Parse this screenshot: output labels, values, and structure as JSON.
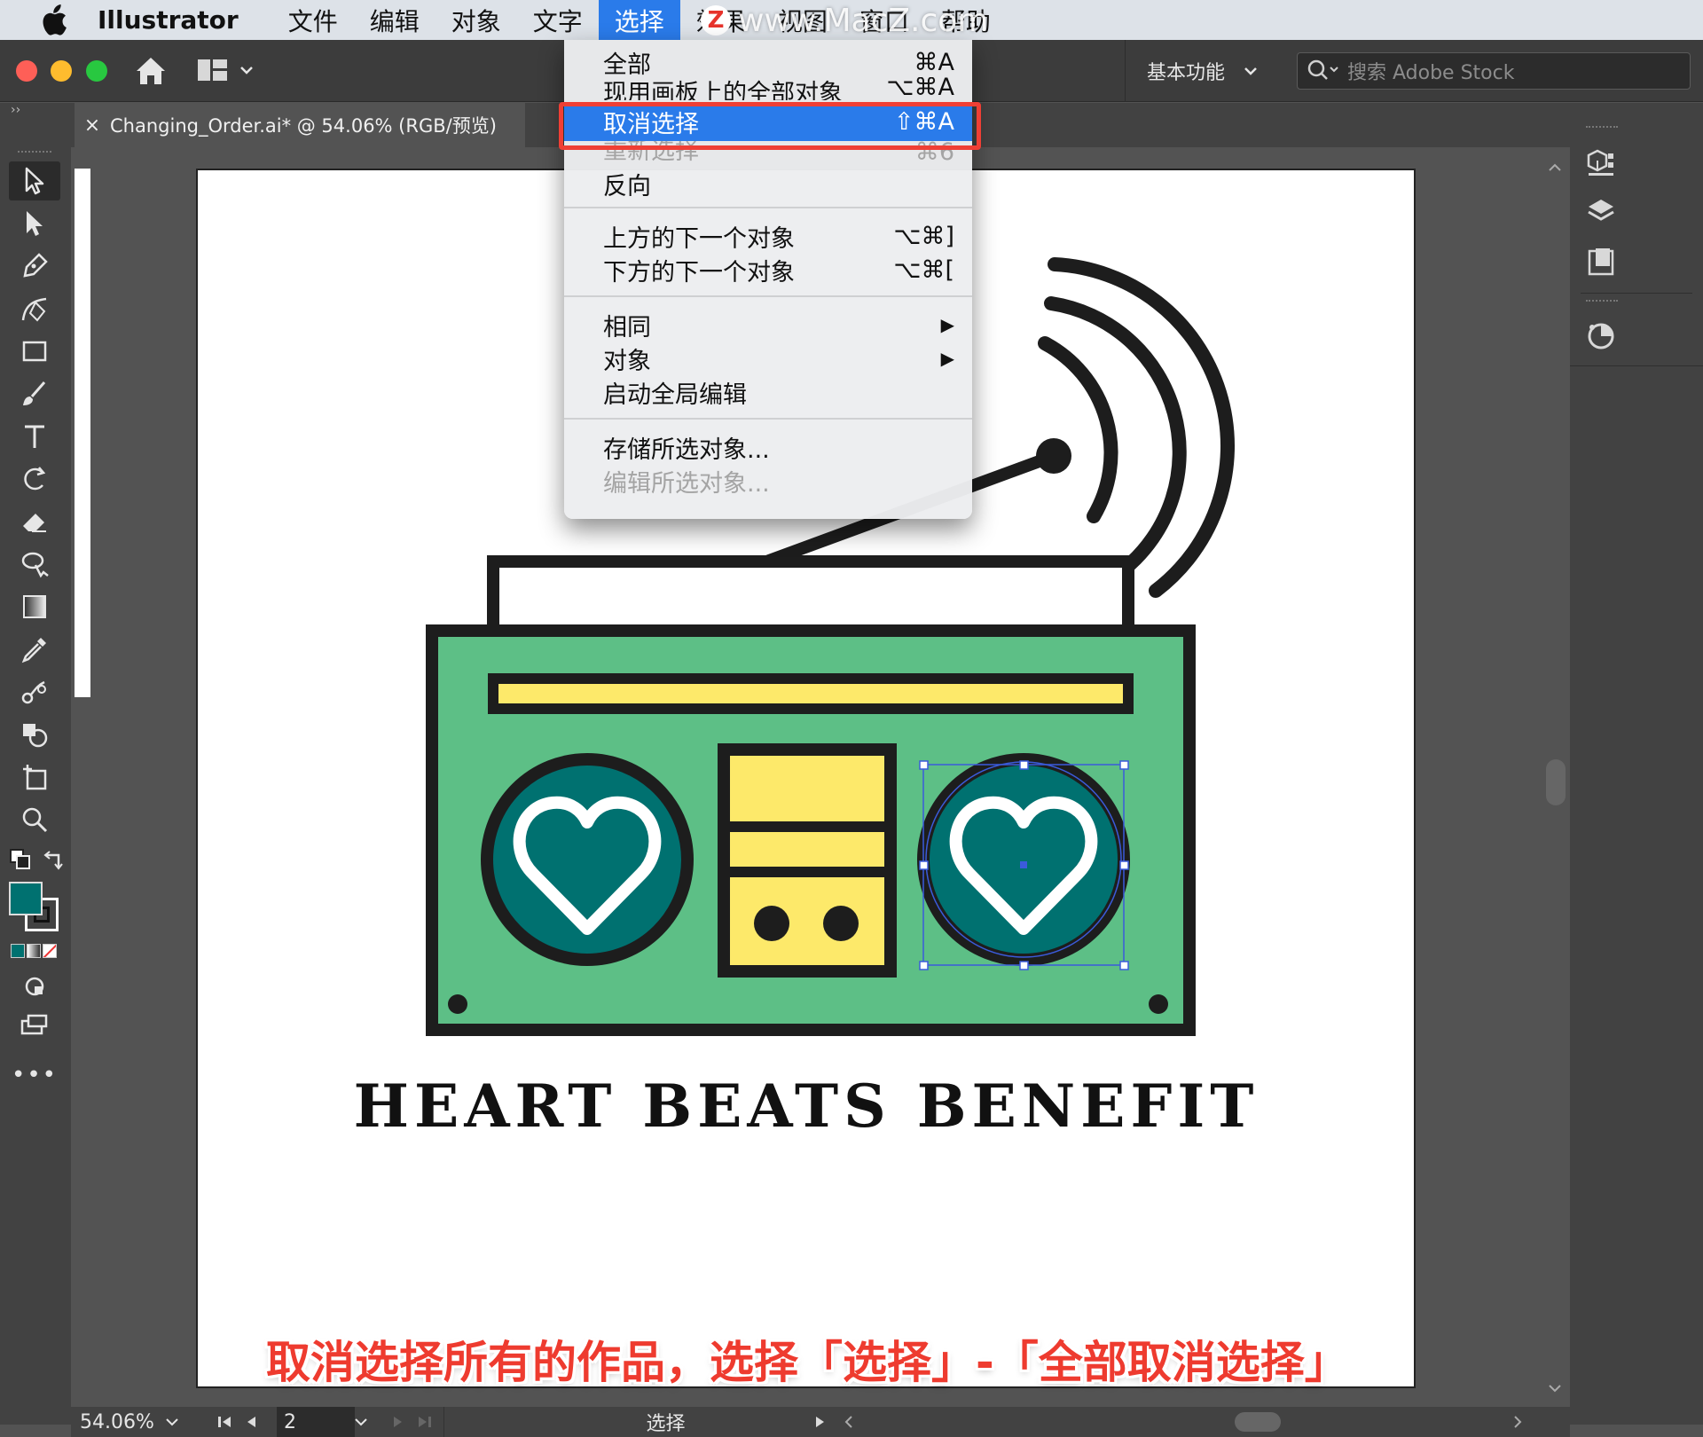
{
  "menubar": {
    "app_name": "Illustrator",
    "items": [
      "文件",
      "编辑",
      "对象",
      "文字",
      "选择",
      "效果",
      "视图",
      "窗口",
      "帮助"
    ],
    "active_item": "选择",
    "watermark": "www.MacZ.com",
    "watermark_logo": "Z"
  },
  "toolbar": {
    "workspace": "基本功能",
    "search_placeholder": "搜索 Adobe Stock"
  },
  "document_tab": {
    "title": "Changing_Order.ai* @ 54.06% (RGB/预览)",
    "close_glyph": "×"
  },
  "select_menu": {
    "items": [
      {
        "label": "全部",
        "shortcut": "⌘A",
        "state": "normal"
      },
      {
        "label": "现用画板上的全部对象",
        "shortcut": "⌥⌘A",
        "state": "normal"
      },
      {
        "label": "取消选择",
        "shortcut": "⇧⌘A",
        "state": "highlighted"
      },
      {
        "label": "重新选择",
        "shortcut": "⌘6",
        "state": "disabled"
      },
      {
        "label": "反向",
        "shortcut": "",
        "state": "normal"
      },
      {
        "label": "上方的下一个对象",
        "shortcut": "⌥⌘]",
        "state": "normal"
      },
      {
        "label": "下方的下一个对象",
        "shortcut": "⌥⌘[",
        "state": "normal"
      },
      {
        "label": "相同",
        "shortcut": "▶",
        "state": "submenu"
      },
      {
        "label": "对象",
        "shortcut": "▶",
        "state": "submenu"
      },
      {
        "label": "启动全局编辑",
        "shortcut": "",
        "state": "normal"
      },
      {
        "label": "存储所选对象...",
        "shortcut": "",
        "state": "normal"
      },
      {
        "label": "编辑所选对象...",
        "shortcut": "",
        "state": "disabled"
      }
    ]
  },
  "artwork": {
    "headline": "HEART BEATS BENEFIT",
    "colors": {
      "body_green": "#5dbf86",
      "speaker_teal": "#007170",
      "yellow": "#fde96a",
      "outline": "#1d1d1d",
      "selection_blue": "#3b5bdb"
    }
  },
  "status": {
    "zoom": "54.06%",
    "artboard_number": "2",
    "tool_name": "选择"
  },
  "caption": "取消选择所有的作品，选择「选择」-「全部取消选择」",
  "colors": {
    "menubar_bg": "#dde2e8",
    "accent": "#2a7bea",
    "callout_red": "#ef3f35",
    "fill_swatch": "#007170"
  },
  "icons": {
    "tools": [
      "selection-tool-icon",
      "direct-selection-tool-icon",
      "pen-tool-icon",
      "curvature-tool-icon",
      "rectangle-tool-icon",
      "paintbrush-tool-icon",
      "type-tool-icon",
      "rotate-tool-icon",
      "eraser-tool-icon",
      "width-tool-icon",
      "gradient-tool-icon",
      "eyedropper-tool-icon",
      "blend-tool-icon",
      "shape-builder-tool-icon",
      "artboard-tool-icon",
      "zoom-tool-icon"
    ],
    "panels": [
      "libraries-panel-icon",
      "layers-panel-icon",
      "artboards-panel-icon",
      "color-guide-panel-icon"
    ]
  }
}
